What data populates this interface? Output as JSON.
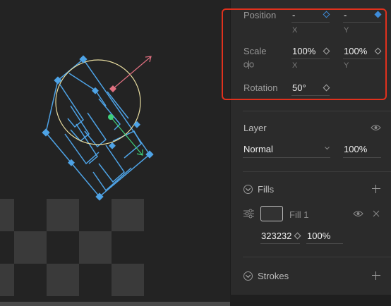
{
  "transform": {
    "position": {
      "label": "Position",
      "x_value": "-",
      "y_value": "-",
      "x_axis": "X",
      "y_axis": "Y"
    },
    "scale": {
      "label": "Scale",
      "x_value": "100%",
      "y_value": "100%",
      "x_axis": "X",
      "y_axis": "Y"
    },
    "rotation": {
      "label": "Rotation",
      "value": "50°"
    }
  },
  "layer": {
    "label": "Layer",
    "blend_mode": "Normal",
    "opacity": "100%"
  },
  "fills": {
    "label": "Fills",
    "items": [
      {
        "name": "Fill 1",
        "hex": "323232",
        "opacity": "100%"
      }
    ]
  },
  "strokes": {
    "label": "Strokes"
  },
  "colors": {
    "accent": "#3d8bd9",
    "highlight": "#e0311d",
    "selection": "#4ea3e6",
    "gizmo_circle": "#e8dda0",
    "gizmo_x": "#e07080",
    "gizmo_y": "#3fd07a"
  }
}
